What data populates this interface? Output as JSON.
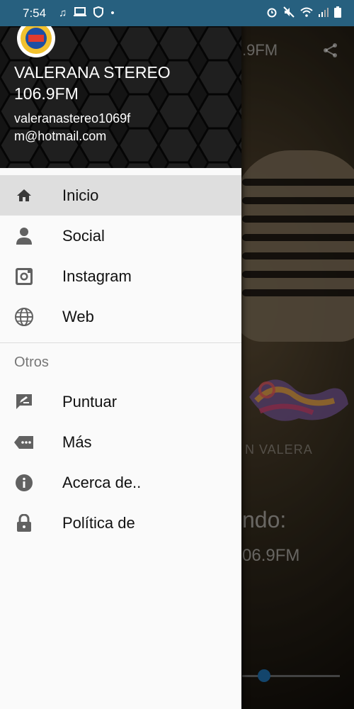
{
  "status_bar": {
    "time": "7:54",
    "left_icons": [
      "music-note-icon",
      "laptop-icon",
      "shield-icon",
      "dot-icon"
    ],
    "right_icons": [
      "alarm-icon",
      "mute-icon",
      "wifi-icon",
      "signal-icon",
      "battery-icon"
    ]
  },
  "background": {
    "title": ".9FM",
    "now_playing": "ndo:",
    "station": "06.9FM",
    "logo_text": "N VALERA",
    "progress": 0.2
  },
  "drawer": {
    "header": {
      "title": "VALERANA STEREO 106.9FM",
      "email": "valeranastereo1069fm@hotmail.com"
    },
    "items": [
      {
        "label": "Inicio",
        "icon": "home-icon",
        "active": true
      },
      {
        "label": "Social",
        "icon": "person-icon",
        "active": false
      },
      {
        "label": "Instagram",
        "icon": "instagram-icon",
        "active": false
      },
      {
        "label": "Web",
        "icon": "globe-icon",
        "active": false
      }
    ],
    "section_title": "Otros",
    "other_items": [
      {
        "label": "Puntuar",
        "icon": "rate-review-icon"
      },
      {
        "label": "Más",
        "icon": "more-tag-icon"
      },
      {
        "label": "Acerca de..",
        "icon": "info-icon"
      },
      {
        "label": "Política de",
        "icon": "lock-icon"
      }
    ]
  },
  "colors": {
    "status_bar": "#27607f",
    "active_item": "#dedede",
    "icon": "#616161",
    "seek_knob": "#1e6aa6"
  }
}
